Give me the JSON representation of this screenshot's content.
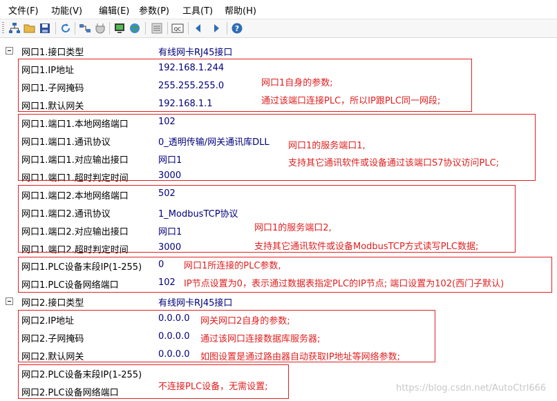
{
  "menu": [
    "文件(F)",
    "功能(V)",
    "编辑(E)",
    "参数(P)",
    "工具(T)",
    "帮助(H)"
  ],
  "toolbar_icons": [
    "network-tree-icon",
    "open-folder-icon",
    "save-disk-icon",
    "refresh-icon",
    "connect-icon",
    "plug-icon",
    "monitor-icon",
    "globe-icon",
    "list-icon",
    "qc-icon",
    "arrow-left-icon",
    "arrow-right-icon",
    "help-icon"
  ],
  "rows": [
    {
      "label": "网口1.接口类型",
      "value": "有线网卡RJ45接口"
    },
    {
      "label": "网口1.IP地址",
      "value": "192.168.1.244"
    },
    {
      "label": "网口1.子网掩码",
      "value": "255.255.255.0"
    },
    {
      "label": "网口1.默认网关",
      "value": "192.168.1.1"
    },
    {
      "label": "网口1.端口1.本地网络端口",
      "value": "102"
    },
    {
      "label": "网口1.端口1.通讯协议",
      "value": "0_透明传输/网关通讯库DLL"
    },
    {
      "label": "网口1.端口1.对应输出接口",
      "value": "网口1"
    },
    {
      "label": "网口1.端口1.超时判定时间",
      "value": "3000"
    },
    {
      "label": "网口1.端口2.本地网络端口",
      "value": "502"
    },
    {
      "label": "网口1.端口2.通讯协议",
      "value": "1_ModbusTCP协议"
    },
    {
      "label": "网口1.端口2.对应输出接口",
      "value": "网口1"
    },
    {
      "label": "网口1.端口2.超时判定时间",
      "value": "3000"
    },
    {
      "label": "网口1.PLC设备末段IP(1-255)",
      "value": "0"
    },
    {
      "label": "网口1.PLC设备网络端口",
      "value": "102"
    },
    {
      "label": "网口2.接口类型",
      "value": "有线网卡RJ45接口"
    },
    {
      "label": "网口2.IP地址",
      "value": "0.0.0.0"
    },
    {
      "label": "网口2.子网掩码",
      "value": "0.0.0.0"
    },
    {
      "label": "网口2.默认网关",
      "value": "0.0.0.0"
    },
    {
      "label": "网口2.PLC设备末段IP(1-255)",
      "value": ""
    },
    {
      "label": "网口2.PLC设备网络端口",
      "value": ""
    }
  ],
  "notes": {
    "g1": [
      "网口1自身的参数;",
      "通过该端口连接PLC，所以IP跟PLC同一网段;"
    ],
    "g2": [
      "网口1的服务端口1,",
      "支持其它通讯软件或设备通过该端口S7协议访问PLC;"
    ],
    "g3": [
      "网口1的服务端口2,",
      "支持其它通讯软件或设备ModbusTCP方式读写PLC数据;"
    ],
    "g4": [
      "网口1所连接的PLC参数,",
      "IP节点设置为0，表示通过数据表指定PLC的IP节点; 端口设置为102(西门子默认)"
    ],
    "g5": [
      "网关网口2自身的参数;",
      "通过该网口连接数据库服务器;",
      "如图设置是通过路由器自动获取IP地址等网络参数;"
    ],
    "g6": [
      "不连接PLC设备，无需设置;"
    ]
  },
  "watermark": "https://blog.csdn.net/AutoCtrl666",
  "colors": {
    "annotation": "#e02020",
    "value": "#00007a"
  }
}
